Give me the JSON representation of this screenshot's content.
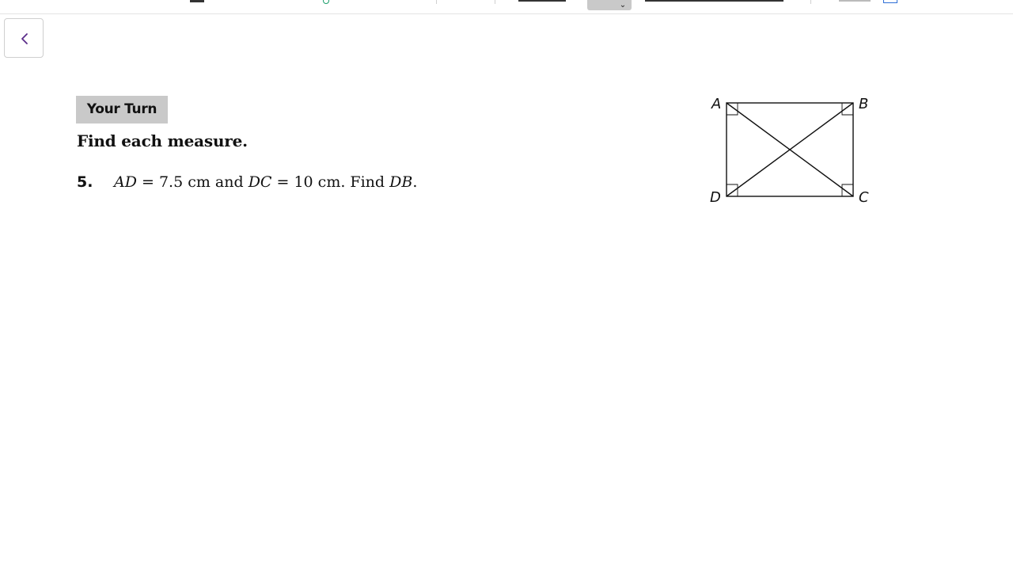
{
  "navigation": {
    "back_icon": "chevron-left-icon"
  },
  "lesson": {
    "section_label": "Your Turn",
    "instruction": "Find each measure.",
    "problem": {
      "number": "5.",
      "seg1": "AD",
      "eq1": " = 7.5 cm and ",
      "seg2": "DC",
      "eq2": " = 10 cm. Find ",
      "seg3": "DB",
      "end": "."
    }
  },
  "figure": {
    "shape": "rectangle",
    "vertices": {
      "a": "A",
      "b": "B",
      "c": "C",
      "d": "D"
    }
  },
  "colors": {
    "section_label_bg": "#c9c9c9",
    "text": "#111111",
    "back_icon": "#5b2d8a"
  }
}
